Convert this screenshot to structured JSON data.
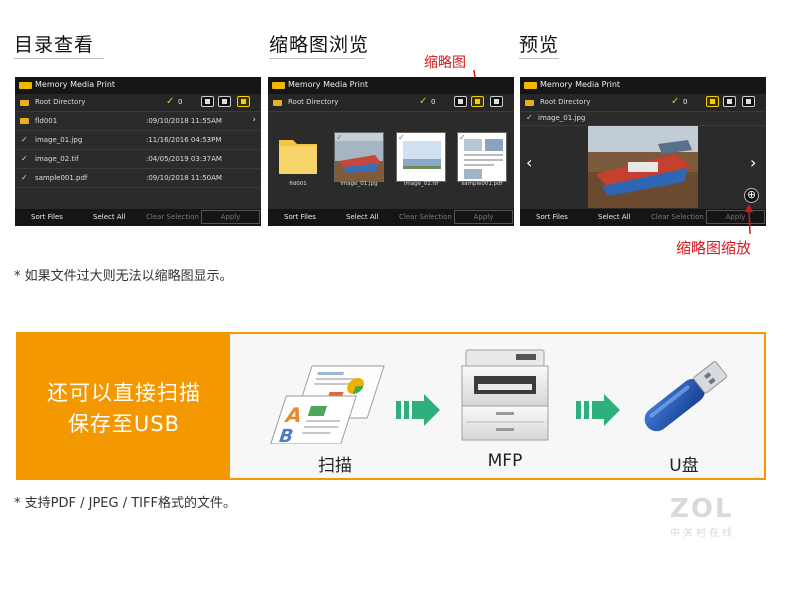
{
  "sections": {
    "list": "目录查看",
    "thumb": "缩略图浏览",
    "preview": "预览"
  },
  "device": {
    "app_title": "Memory Media Print",
    "root_dir": "Root Directory",
    "selected_count": "0",
    "sort_files": "Sort Files",
    "select_all": "Select All",
    "clear_selection": "Clear Selection",
    "apply": "Apply"
  },
  "list_files": [
    {
      "name": "fld001",
      "date": ":09/10/2018 11:55AM",
      "type": "folder"
    },
    {
      "name": "image_01.jpg",
      "date": ":11/16/2016 04:53PM",
      "type": "file"
    },
    {
      "name": "image_02.tif",
      "date": ":04/05/2019 03:37AM",
      "type": "file"
    },
    {
      "name": "sample001.pdf",
      "date": ":09/10/2018 11:50AM",
      "type": "file"
    }
  ],
  "thumbs": [
    "fld001",
    "image_01.jpg",
    "image_02.tif",
    "sample001.pdf"
  ],
  "preview_file": "image_01.jpg",
  "callouts": {
    "thumbnail": "缩略图",
    "zoom": "缩略图缩放"
  },
  "notes": {
    "top": "* 如果文件过大则无法以缩略图显示。",
    "bottom": "* 支持PDF / JPEG / TIFF格式的文件。"
  },
  "banner": {
    "line1": "还可以直接扫描",
    "line2": "保存至USB",
    "step_scan": "扫描",
    "step_mfp": "MFP",
    "step_usb": "U盘"
  },
  "watermark": {
    "logo": "ZOL",
    "sub": "中关村在线"
  },
  "colors": {
    "accent_orange": "#f39800",
    "callout_red": "#d7191c",
    "arrow_green": "#2db07c",
    "usb_blue": "#1f4fa8",
    "panel_dark": "#2b2b2b",
    "highlight_yellow": "#f5d000"
  }
}
